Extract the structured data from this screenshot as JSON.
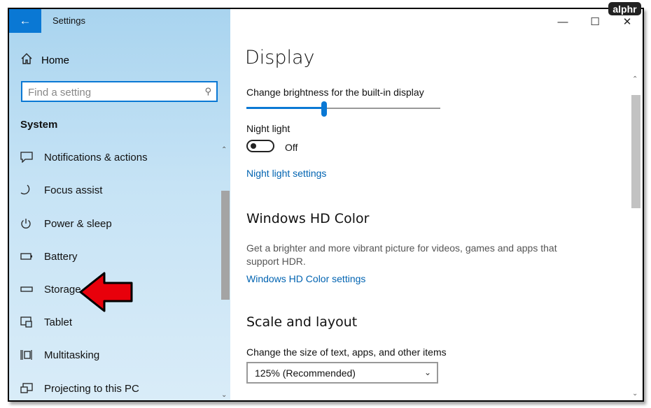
{
  "app": {
    "title": "Settings",
    "back_icon": "back-arrow-icon"
  },
  "watermark": "alphr",
  "sidebar": {
    "home_label": "Home",
    "search": {
      "placeholder": "Find a setting"
    },
    "section_label": "System",
    "items": [
      {
        "label": "Notifications & actions",
        "icon": "notification-icon"
      },
      {
        "label": "Focus assist",
        "icon": "moon-icon"
      },
      {
        "label": "Power & sleep",
        "icon": "power-icon"
      },
      {
        "label": "Battery",
        "icon": "battery-icon"
      },
      {
        "label": "Storage",
        "icon": "storage-icon"
      },
      {
        "label": "Tablet",
        "icon": "tablet-icon"
      },
      {
        "label": "Multitasking",
        "icon": "multitasking-icon"
      },
      {
        "label": "Projecting to this PC",
        "icon": "projector-icon"
      }
    ]
  },
  "main": {
    "title": "Display",
    "brightness": {
      "label": "Change brightness for the built-in display",
      "value": 0.4
    },
    "night_light": {
      "label": "Night light",
      "state": "Off",
      "link": "Night light settings"
    },
    "hd_color": {
      "heading": "Windows HD Color",
      "description": "Get a brighter and more vibrant picture for videos, games and apps that support HDR.",
      "link": "Windows HD Color settings"
    },
    "scale": {
      "heading": "Scale and layout",
      "label": "Change the size of text, apps, and other items",
      "selected": "125% (Recommended)"
    }
  },
  "colors": {
    "accent": "#0a78d4",
    "annotation_arrow": "#e8000b"
  }
}
